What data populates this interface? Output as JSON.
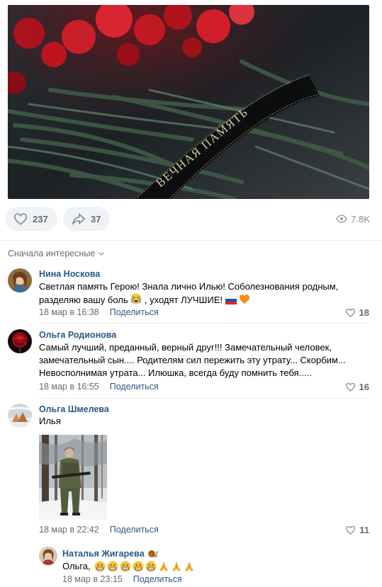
{
  "post": {
    "photo_ribbon_text": "ВЕЧНАЯ ПАМЯТЬ",
    "likes": "237",
    "shares": "37",
    "views": "7.8K"
  },
  "sort_label": "Сначала интересные",
  "comments": [
    {
      "author": "Нина Носкова",
      "lines": [
        "Светлая память Герою! Знала лично Илью! Соболезнования родным,",
        "разделяю вашу боль",
        ", уходят ЛУЧШИЕ!"
      ],
      "date": "18 мар в 16:38",
      "share": "Поделиться",
      "likes": "18"
    },
    {
      "author": "Ольга Родионова",
      "lines": [
        "Самый лучший, преданный, верный друг!!! Замечательный человек,",
        "замечательный сын.... Родителям сил пережить эту утрату... Скорбим...",
        "Невосполнимая утрата... Илюшка, всегда буду помнить тебя....."
      ],
      "date": "18 мар в 16:55",
      "share": "Поделиться",
      "likes": "16"
    },
    {
      "author": "Ольга Шмелева",
      "lines": [
        "Илья"
      ],
      "date": "18 мар в 22:42",
      "share": "Поделиться",
      "likes": "11"
    },
    {
      "author": "Наталья Жигарева",
      "lines": [
        "Ольга,"
      ],
      "date": "18 мар в 23:15",
      "share": "Поделиться",
      "likes": ""
    }
  ],
  "colors": {
    "link": "#2a5885",
    "secondary": "#626d7a",
    "pill_bg": "#f0f2f5",
    "separator": "#e7e8ec"
  },
  "icons": [
    "heart-icon",
    "share-arrow-icon",
    "eye-icon",
    "chevron-down-icon",
    "crying-face-emoji",
    "russian-flag-emoji",
    "orange-heart-emoji",
    "grimacing-face-emoji",
    "praying-hands-emoji",
    "snail-emoji"
  ]
}
